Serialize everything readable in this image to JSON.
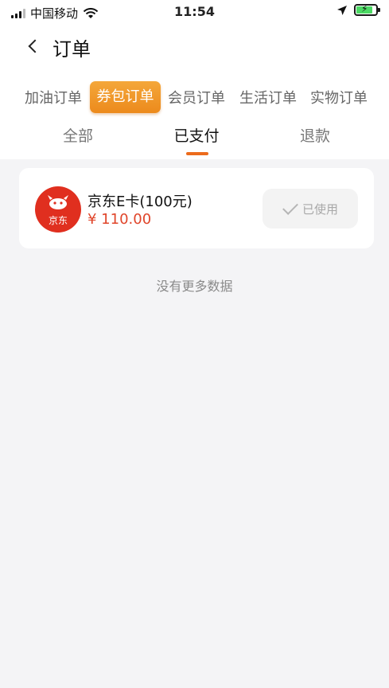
{
  "status_bar": {
    "carrier": "中国移动",
    "time": "11:54"
  },
  "header": {
    "title": "订单"
  },
  "category_tabs": [
    {
      "label": "加油订单"
    },
    {
      "label": "券包订单",
      "active": true
    },
    {
      "label": "会员订单"
    },
    {
      "label": "生活订单"
    },
    {
      "label": "实物订单"
    }
  ],
  "status_tabs": [
    {
      "label": "全部"
    },
    {
      "label": "已支付",
      "active": true
    },
    {
      "label": "退款"
    }
  ],
  "orders": [
    {
      "logo_text": "京东",
      "product": "京东E卡(100元)",
      "price": "¥ 110.00",
      "status": "已使用"
    }
  ],
  "empty_hint": "没有更多数据",
  "colors": {
    "accent": "#ec8a1c",
    "price": "#e0452a",
    "logo_bg": "#e02f1f"
  }
}
